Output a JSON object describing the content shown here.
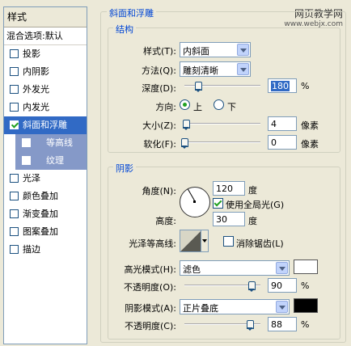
{
  "styles_panel": {
    "header": "样式",
    "blend_options": "混合选项:默认",
    "items": [
      {
        "label": "投影",
        "checked": false
      },
      {
        "label": "内阴影",
        "checked": false
      },
      {
        "label": "外发光",
        "checked": false
      },
      {
        "label": "内发光",
        "checked": false
      },
      {
        "label": "斜面和浮雕",
        "checked": true,
        "selected": true
      },
      {
        "label": "等高线",
        "checked": false,
        "sub": true
      },
      {
        "label": "纹理",
        "checked": false,
        "sub": true
      },
      {
        "label": "光泽",
        "checked": false
      },
      {
        "label": "颜色叠加",
        "checked": false
      },
      {
        "label": "渐变叠加",
        "checked": false
      },
      {
        "label": "图案叠加",
        "checked": false
      },
      {
        "label": "描边",
        "checked": false
      }
    ]
  },
  "watermark": {
    "line1": "网页教学网",
    "line2": "www.webjx.com"
  },
  "bevel": {
    "section_title": "斜面和浮雕",
    "structure": {
      "title": "结构",
      "style_label": "样式(T):",
      "style_value": "内斜面",
      "technique_label": "方法(Q):",
      "technique_value": "雕刻清晰",
      "depth_label": "深度(D):",
      "depth_value": "180",
      "depth_fraction": 0.18,
      "depth_unit": "%",
      "direction_label": "方向:",
      "direction_up": "上",
      "direction_down": "下",
      "size_label": "大小(Z):",
      "size_value": "4",
      "size_fraction": 0.02,
      "size_unit": "像素",
      "soften_label": "软化(F):",
      "soften_value": "0",
      "soften_fraction": 0.0,
      "soften_unit": "像素"
    },
    "shading": {
      "title": "阴影",
      "angle_label": "角度(N):",
      "angle_value": "120",
      "angle_unit": "度",
      "global_light_label": "使用全局光(G)",
      "altitude_label": "高度:",
      "altitude_value": "30",
      "altitude_unit": "度",
      "gloss_contour_label": "光泽等高线:",
      "antialias_label": "消除锯齿(L)",
      "highlight_mode_label": "高光模式(H):",
      "highlight_mode_value": "滤色",
      "highlight_color": "#ffffff",
      "highlight_opacity_label": "不透明度(O):",
      "highlight_opacity_value": "90",
      "highlight_opacity_unit": "%",
      "shadow_mode_label": "阴影模式(A):",
      "shadow_mode_value": "正片叠底",
      "shadow_color": "#000000",
      "shadow_opacity_label": "不透明度(C):",
      "shadow_opacity_value": "88",
      "shadow_opacity_unit": "%"
    }
  }
}
